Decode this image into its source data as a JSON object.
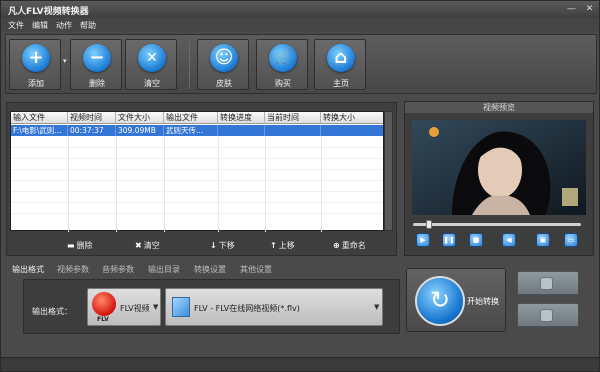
{
  "app": {
    "title": "凡人FLV视频转换器"
  },
  "window_controls": {
    "minimize": "—",
    "close": "✕"
  },
  "menu": [
    "文件",
    "编辑",
    "动作",
    "帮助"
  ],
  "toolbar": {
    "buttons": [
      {
        "label": "添加",
        "icon": "plus-icon",
        "symbol": "+"
      },
      {
        "label": "删除",
        "icon": "minus-icon",
        "symbol": "−"
      },
      {
        "label": "清空",
        "icon": "clear-icon",
        "symbol": "✕"
      },
      {
        "label": "皮肤",
        "icon": "smiley-icon",
        "symbol": "☺"
      },
      {
        "label": "购买",
        "icon": "cart-icon",
        "symbol": "🛒"
      },
      {
        "label": "主页",
        "icon": "home-icon",
        "symbol": "⌂"
      }
    ],
    "dropdown_arrow": "▾"
  },
  "file_table": {
    "columns": [
      "输入文件",
      "视频时间",
      "文件大小",
      "输出文件",
      "转换进度",
      "当前时间",
      "转换大小"
    ],
    "rows": [
      {
        "input_file": "F:\\电影\\武则...",
        "video_time": "00:37:37",
        "file_size": "309.09MB",
        "output_file": "武则天传...",
        "progress": "",
        "current_time": "",
        "converted_size": ""
      }
    ]
  },
  "list_actions": [
    {
      "label": "删除",
      "icon": "minus-icon",
      "glyph": "▬"
    },
    {
      "label": "清空",
      "icon": "x-icon",
      "glyph": "✖"
    },
    {
      "label": "下移",
      "icon": "arrow-down-icon",
      "glyph": "↓"
    },
    {
      "label": "上移",
      "icon": "arrow-up-icon",
      "glyph": "↑"
    },
    {
      "label": "重命名",
      "icon": "rename-icon",
      "glyph": "⊕"
    }
  ],
  "preview": {
    "title": "视频预览",
    "seek_position": 0.08
  },
  "player_controls": [
    {
      "icon": "play-icon",
      "glyph": "▶"
    },
    {
      "icon": "pause-icon",
      "glyph": "❚❚"
    },
    {
      "icon": "stop-icon",
      "glyph": "■"
    },
    {
      "icon": "volume-icon",
      "glyph": "◀"
    },
    {
      "icon": "snapshot-icon",
      "glyph": "▣"
    },
    {
      "icon": "folder-icon",
      "glyph": "▭"
    }
  ],
  "settings_tabs": [
    "输出格式",
    "视频参数",
    "音频参数",
    "输出目录",
    "转换设置",
    "其他设置"
  ],
  "output": {
    "label": "输出格式：",
    "format": "FLV视频",
    "format_icon_text": "FLV",
    "profile": "FLV - FLV在线网络视频(*.flv)",
    "select_arrow": "▼"
  },
  "start_button": {
    "label": "开始转换",
    "icon": "convert-arrow-icon",
    "glyph": "↻"
  },
  "colors": {
    "window_bg": "#4a4a4a",
    "selection": "#3476d6",
    "accent_blue": "#1a7ad4",
    "flv_red": "#d4120a"
  }
}
